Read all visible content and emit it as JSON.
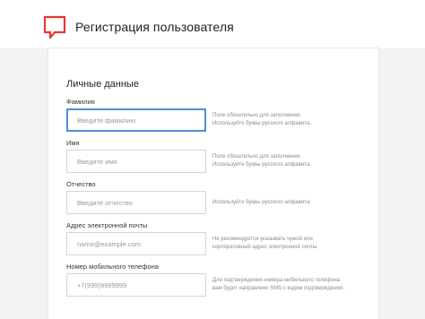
{
  "header": {
    "title": "Регистрация пользователя",
    "logo_icon": "speech-bubble-icon",
    "logo_color": "#e23a2e"
  },
  "form": {
    "section_title": "Личные данные",
    "fields": [
      {
        "label": "Фамилия",
        "placeholder": "Введите фамилию",
        "value": "",
        "focused": true,
        "hint_line1": "Поле обязательно для заполнения.",
        "hint_line2": "Используйте буквы русского алфавита."
      },
      {
        "label": "Имя",
        "placeholder": "Введите имя",
        "value": "",
        "focused": false,
        "hint_line1": "Поле обязательно для заполнения.",
        "hint_line2": "Используйте буквы русского алфавита."
      },
      {
        "label": "Отчество",
        "placeholder": "Введите отчество",
        "value": "",
        "focused": false,
        "hint_line1": "Используйте буквы русского алфавита.",
        "hint_line2": ""
      },
      {
        "label": "Адрес электронной почты",
        "placeholder": "name@example.com",
        "value": "",
        "focused": false,
        "hint_line1": "Не рекомендуется указывать чужой или",
        "hint_line2": "корпоративный адрес электронной почты."
      },
      {
        "label": "Номер мобильного телефона",
        "placeholder": "+7(999)9999999",
        "value": "",
        "focused": false,
        "hint_line1": "Для подтверждения номера мобильного телефона",
        "hint_line2": "вам будет направлено SMS с кодом подтверждения."
      }
    ]
  },
  "colors": {
    "accent": "#e23a2e",
    "focus_border": "#4a90d9"
  }
}
